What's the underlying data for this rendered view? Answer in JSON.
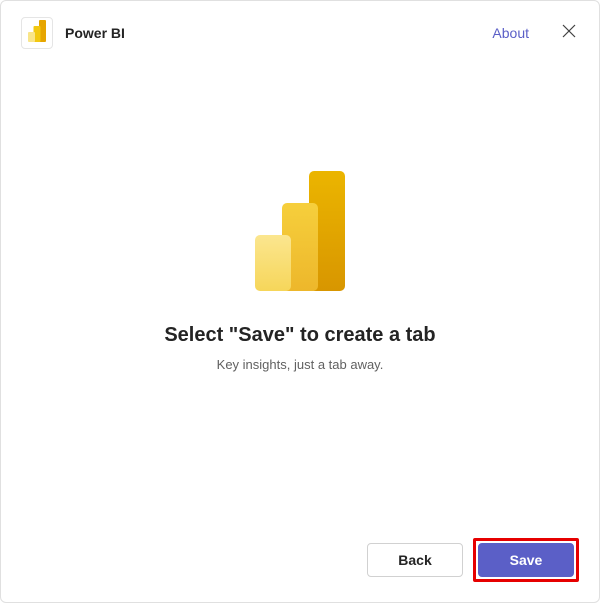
{
  "header": {
    "app_name": "Power BI",
    "about_label": "About"
  },
  "content": {
    "heading": "Select \"Save\" to create a tab",
    "subheading": "Key insights, just a tab away."
  },
  "footer": {
    "back_label": "Back",
    "save_label": "Save"
  },
  "icons": {
    "app_icon": "power-bi-icon",
    "close": "close-icon",
    "hero": "power-bi-hero-icon"
  }
}
